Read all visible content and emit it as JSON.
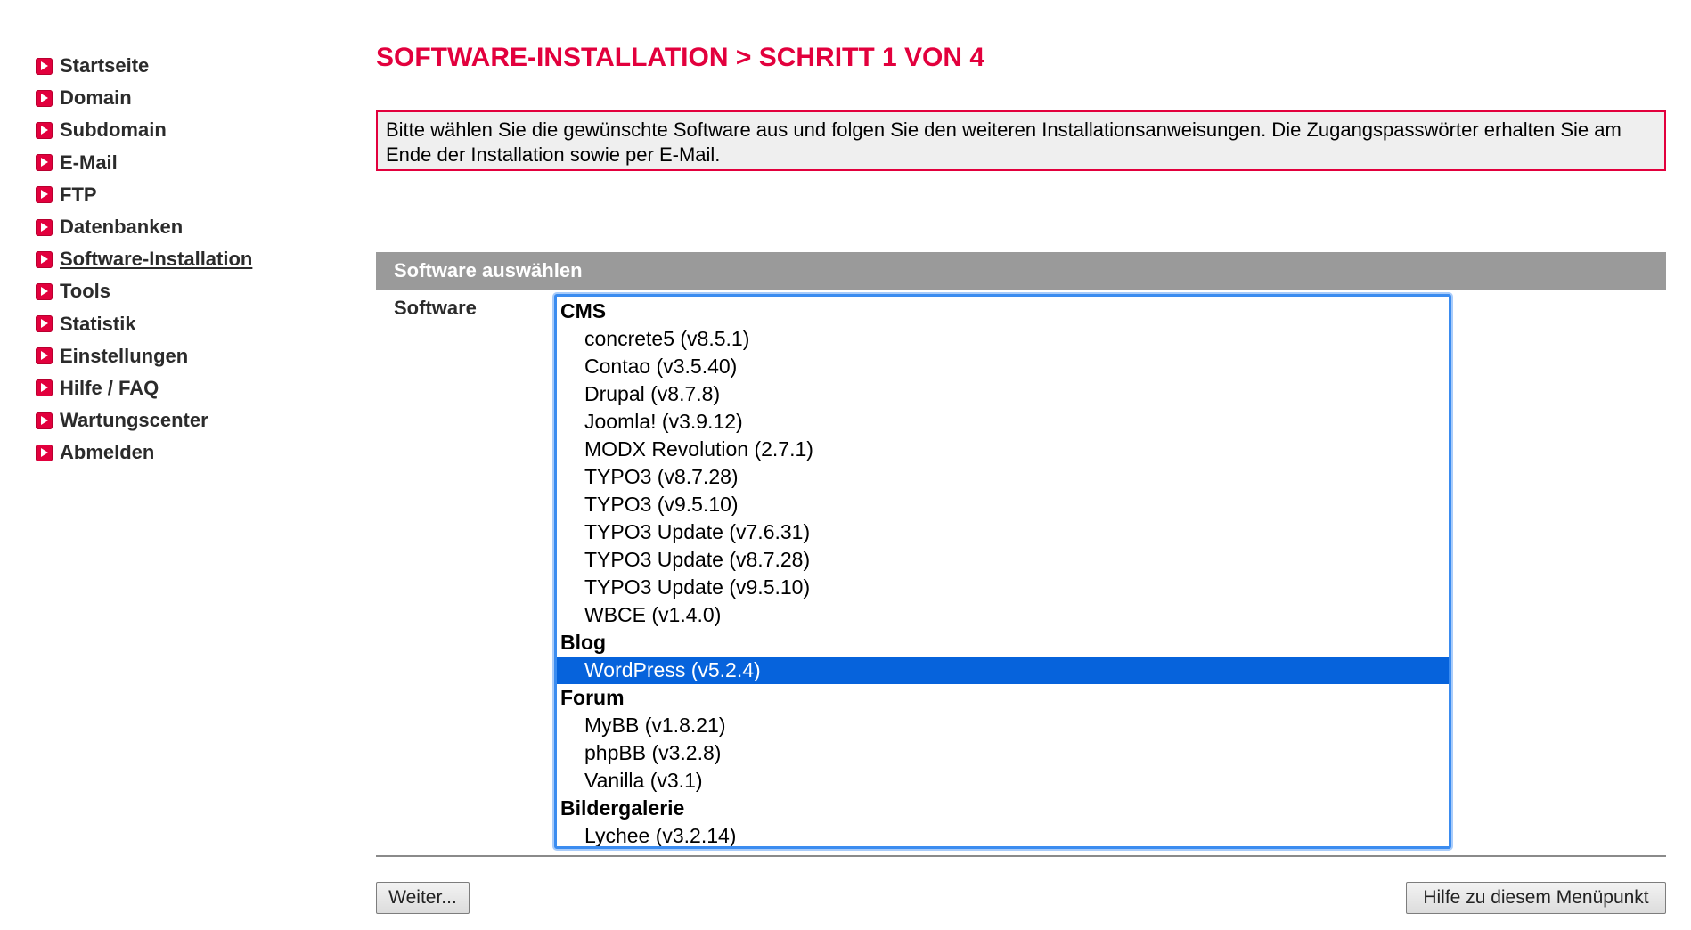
{
  "nav": {
    "items": [
      {
        "label": "Startseite"
      },
      {
        "label": "Domain"
      },
      {
        "label": "Subdomain"
      },
      {
        "label": "E-Mail"
      },
      {
        "label": "FTP"
      },
      {
        "label": "Datenbanken"
      },
      {
        "label": "Software-Installation"
      },
      {
        "label": "Tools"
      },
      {
        "label": "Statistik"
      },
      {
        "label": "Einstellungen"
      },
      {
        "label": "Hilfe / FAQ"
      },
      {
        "label": "Wartungscenter"
      },
      {
        "label": "Abmelden"
      }
    ],
    "active": "Software-Installation"
  },
  "page": {
    "title": "SOFTWARE-INSTALLATION > SCHRITT 1 VON 4",
    "info": "Bitte wählen Sie die gewünschte Software aus und folgen Sie den weiteren Installationsanweisungen. Die Zugangspasswörter erhalten Sie am Ende der Installation sowie per E-Mail."
  },
  "section": {
    "title": "Software auswählen",
    "field_label": "Software"
  },
  "software_list": {
    "selected": "WordPress (v5.2.4)",
    "groups": [
      {
        "label": "CMS",
        "options": [
          "concrete5 (v8.5.1)",
          "Contao (v3.5.40)",
          "Drupal (v8.7.8)",
          "Joomla! (v3.9.12)",
          "MODX Revolution (2.7.1)",
          "TYPO3 (v8.7.28)",
          "TYPO3 (v9.5.10)",
          "TYPO3 Update (v7.6.31)",
          "TYPO3 Update (v8.7.28)",
          "TYPO3 Update (v9.5.10)",
          "WBCE (v1.4.0)"
        ]
      },
      {
        "label": "Blog",
        "options": [
          "WordPress (v5.2.4)"
        ]
      },
      {
        "label": "Forum",
        "options": [
          "MyBB (v1.8.21)",
          "phpBB (v3.2.8)",
          "Vanilla (v3.1)"
        ]
      },
      {
        "label": "Bildergalerie",
        "options": [
          "Lychee (v3.2.14)"
        ]
      }
    ]
  },
  "buttons": {
    "next": "Weiter...",
    "help": "Hilfe zu diesem Menüpunkt"
  },
  "colors": {
    "accent": "#e2003d",
    "section_bar": "#9a9a9a",
    "selection": "#0663dc",
    "focus_ring": "#3b8cf0"
  }
}
